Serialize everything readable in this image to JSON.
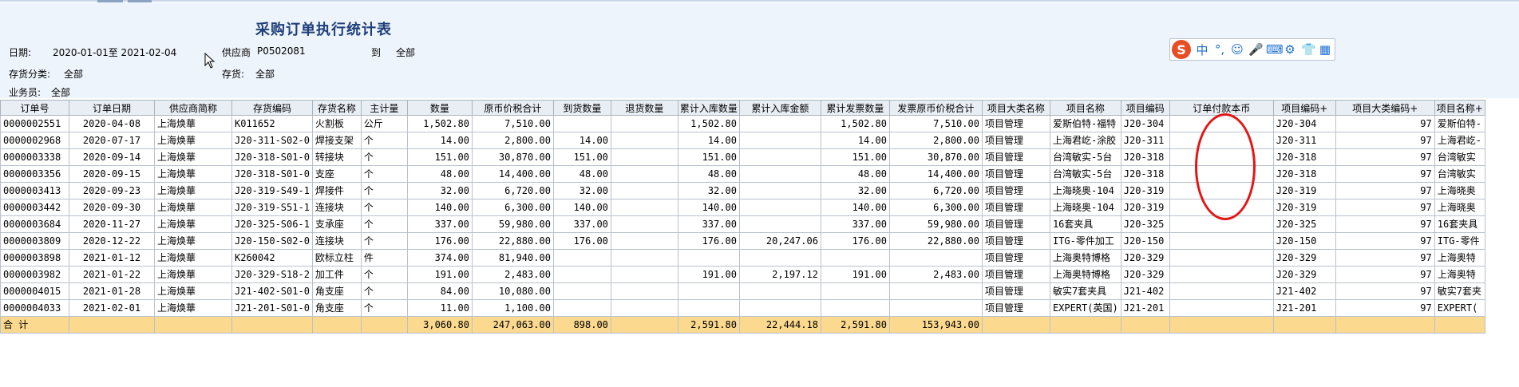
{
  "title": "采购订单执行统计表",
  "filters": {
    "date_label": "日期:",
    "date_value": "2020-01-01至 2021-02-04",
    "supplier_label": "供应商",
    "supplier_value": "P0502081",
    "to_label": "到",
    "to_value": "全部",
    "inv_class_label": "存货分类:",
    "inv_class_value": "全部",
    "inv_label": "存货:",
    "inv_value": "全部",
    "salesman_label": "业务员:",
    "salesman_value": "全部"
  },
  "ime": {
    "logo": "S",
    "items": [
      "中",
      "°,",
      "☺",
      "🎤",
      "⌨",
      "⚙",
      "👕",
      "▦"
    ]
  },
  "colors": {
    "header_bg": "#eef4fb",
    "total_bg": "#fbd98f",
    "annotation": "#e31616",
    "title": "#1f3f7a"
  },
  "table": {
    "columns": [
      "订单号",
      "订单日期",
      "供应商简称",
      "存货编码",
      "存货名称",
      "主计量",
      "数量",
      "原币价税合计",
      "到货数量",
      "退货数量",
      "累计入库数量",
      "累计入库金额",
      "累计发票数量",
      "发票原币价税合计",
      "项目大类名称",
      "项目名称",
      "项目编码",
      "订单付款本币",
      "项目编码+",
      "项目大类编码+",
      "项目名称+"
    ],
    "rows": [
      [
        "0000002551",
        "2020-04-08",
        "上海焕華",
        "K011652",
        "火割板",
        "公斤",
        "1,502.80",
        "7,510.00",
        "",
        "",
        "1,502.80",
        "",
        "1,502.80",
        "7,510.00",
        "项目管理",
        "爱斯伯特-福特",
        "J20-304",
        "",
        "J20-304",
        "97",
        "爱斯伯特-"
      ],
      [
        "0000002968",
        "2020-07-17",
        "上海焕華",
        "J20-311-S02-0",
        "焊接支架",
        "个",
        "14.00",
        "2,800.00",
        "14.00",
        "",
        "14.00",
        "",
        "14.00",
        "2,800.00",
        "项目管理",
        "上海君屹-涂胶",
        "J20-311",
        "",
        "J20-311",
        "97",
        "上海君屹-"
      ],
      [
        "0000003338",
        "2020-09-14",
        "上海焕華",
        "J20-318-S01-0",
        "转接块",
        "个",
        "151.00",
        "30,870.00",
        "151.00",
        "",
        "151.00",
        "",
        "151.00",
        "30,870.00",
        "项目管理",
        "台湾敏实-5台",
        "J20-318",
        "",
        "J20-318",
        "97",
        "台湾敏实"
      ],
      [
        "0000003356",
        "2020-09-15",
        "上海焕華",
        "J20-318-S01-0",
        "支座",
        "个",
        "48.00",
        "14,400.00",
        "48.00",
        "",
        "48.00",
        "",
        "48.00",
        "14,400.00",
        "项目管理",
        "台湾敏实-5台",
        "J20-318",
        "",
        "J20-318",
        "97",
        "台湾敏实"
      ],
      [
        "0000003413",
        "2020-09-23",
        "上海焕華",
        "J20-319-S49-1",
        "焊接件",
        "个",
        "32.00",
        "6,720.00",
        "32.00",
        "",
        "32.00",
        "",
        "32.00",
        "6,720.00",
        "项目管理",
        "上海晓奥-104",
        "J20-319",
        "",
        "J20-319",
        "97",
        "上海晓奥"
      ],
      [
        "0000003442",
        "2020-09-30",
        "上海焕華",
        "J20-319-S51-1",
        "连接块",
        "个",
        "140.00",
        "6,300.00",
        "140.00",
        "",
        "140.00",
        "",
        "140.00",
        "6,300.00",
        "项目管理",
        "上海晓奥-104",
        "J20-319",
        "",
        "J20-319",
        "97",
        "上海晓奥"
      ],
      [
        "0000003684",
        "2020-11-27",
        "上海焕華",
        "J20-325-S06-1",
        "支承座",
        "个",
        "337.00",
        "59,980.00",
        "337.00",
        "",
        "337.00",
        "",
        "337.00",
        "59,980.00",
        "项目管理",
        "16套夹具",
        "J20-325",
        "",
        "J20-325",
        "97",
        "16套夹具"
      ],
      [
        "0000003809",
        "2020-12-22",
        "上海焕華",
        "J20-150-S02-0",
        "连接块",
        "个",
        "176.00",
        "22,880.00",
        "176.00",
        "",
        "176.00",
        "20,247.06",
        "176.00",
        "22,880.00",
        "项目管理",
        "ITG-零件加工",
        "J20-150",
        "",
        "J20-150",
        "97",
        "ITG-零件"
      ],
      [
        "0000003898",
        "2021-01-12",
        "上海焕華",
        "K260042",
        "欧标立柱",
        "件",
        "374.00",
        "81,940.00",
        "",
        "",
        "",
        "",
        "",
        "",
        "项目管理",
        "上海奥特博格",
        "J20-329",
        "",
        "J20-329",
        "97",
        "上海奥特"
      ],
      [
        "0000003982",
        "2021-01-22",
        "上海焕華",
        "J20-329-S18-2",
        "加工件",
        "个",
        "191.00",
        "2,483.00",
        "",
        "",
        "191.00",
        "2,197.12",
        "191.00",
        "2,483.00",
        "项目管理",
        "上海奥特博格",
        "J20-329",
        "",
        "J20-329",
        "97",
        "上海奥特"
      ],
      [
        "0000004015",
        "2021-01-28",
        "上海焕華",
        "J21-402-S01-0",
        "角支座",
        "个",
        "84.00",
        "10,080.00",
        "",
        "",
        "",
        "",
        "",
        "",
        "项目管理",
        "敏实7套夹具",
        "J21-402",
        "",
        "J21-402",
        "97",
        "敏实7套夹"
      ],
      [
        "0000004033",
        "2021-02-01",
        "上海焕華",
        "J21-201-S01-0",
        "角支座",
        "个",
        "11.00",
        "1,100.00",
        "",
        "",
        "",
        "",
        "",
        "",
        "项目管理",
        "EXPERT(英国)",
        "J21-201",
        "",
        "J21-201",
        "97",
        "EXPERT("
      ]
    ],
    "total": [
      "合  计",
      "",
      "",
      "",
      "",
      "",
      "3,060.80",
      "247,063.00",
      "898.00",
      "",
      "2,591.80",
      "22,444.18",
      "2,591.80",
      "153,943.00",
      "",
      "",
      "",
      "",
      "",
      "",
      ""
    ]
  }
}
